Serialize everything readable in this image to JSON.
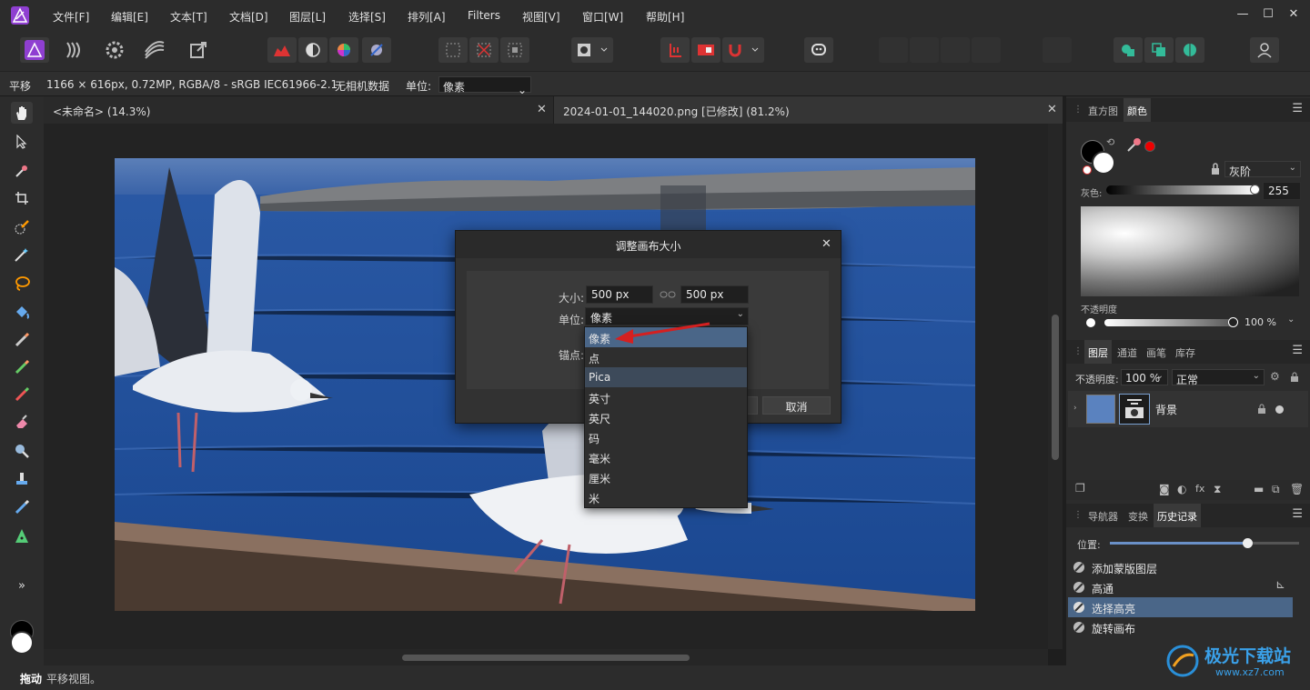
{
  "menubar": {
    "items": [
      "文件[F]",
      "编辑[E]",
      "文本[T]",
      "文档[D]",
      "图层[L]",
      "选择[S]",
      "排列[A]",
      "Filters",
      "视图[V]",
      "窗口[W]",
      "帮助[H]"
    ],
    "minimize": "—",
    "maximize": "☐",
    "close": "✕"
  },
  "context": {
    "tool_name": "平移",
    "doc_info": "1166 × 616px, 0.72MP, RGBA/8 - sRGB IEC61966-2.1",
    "camera": "无相机数据",
    "unit_label": "单位:",
    "unit_value": "像素"
  },
  "tabs": [
    {
      "label": "<未命名> (14.3%)",
      "close": "✕"
    },
    {
      "label": "2024-01-01_144020.png [已修改] (81.2%)",
      "close": "✕"
    }
  ],
  "dialog": {
    "title": "调整画布大小",
    "close": "✕",
    "size_label": "大小:",
    "width": "500 px",
    "height": "500 px",
    "unit_label": "单位:",
    "unit_value": "像素",
    "anchor_label": "锚点:",
    "cancel": "取消"
  },
  "unit_options": [
    "像素",
    "点",
    "Pica",
    "英寸",
    "英尺",
    "码",
    "毫米",
    "厘米",
    "米"
  ],
  "color_panel": {
    "tabs": [
      "直方图",
      "颜色"
    ],
    "mode": "灰阶",
    "gray_label": "灰色:",
    "gray_value": "255",
    "opacity_label": "不透明度",
    "opacity_value": "100 %"
  },
  "layers_panel": {
    "tabs": [
      "图层",
      "通道",
      "画笔",
      "库存"
    ],
    "opacity_label": "不透明度:",
    "opacity_value": "100 %",
    "blend_mode": "正常",
    "layer_name": "背景"
  },
  "history_panel": {
    "tabs": [
      "导航器",
      "变换",
      "历史记录"
    ],
    "position_label": "位置:",
    "items": [
      "添加蒙版图层",
      "高通",
      "选择高亮",
      "旋转画布"
    ]
  },
  "status": {
    "action": "拖动",
    "hint": "平移视图。"
  },
  "watermark": {
    "title": "极光下载站",
    "url": "www.xz7.com"
  },
  "colors": {
    "accent": "#4a6688",
    "brand": "#8f3fd1",
    "selection": "#4a6688",
    "arrow": "#d42020"
  }
}
